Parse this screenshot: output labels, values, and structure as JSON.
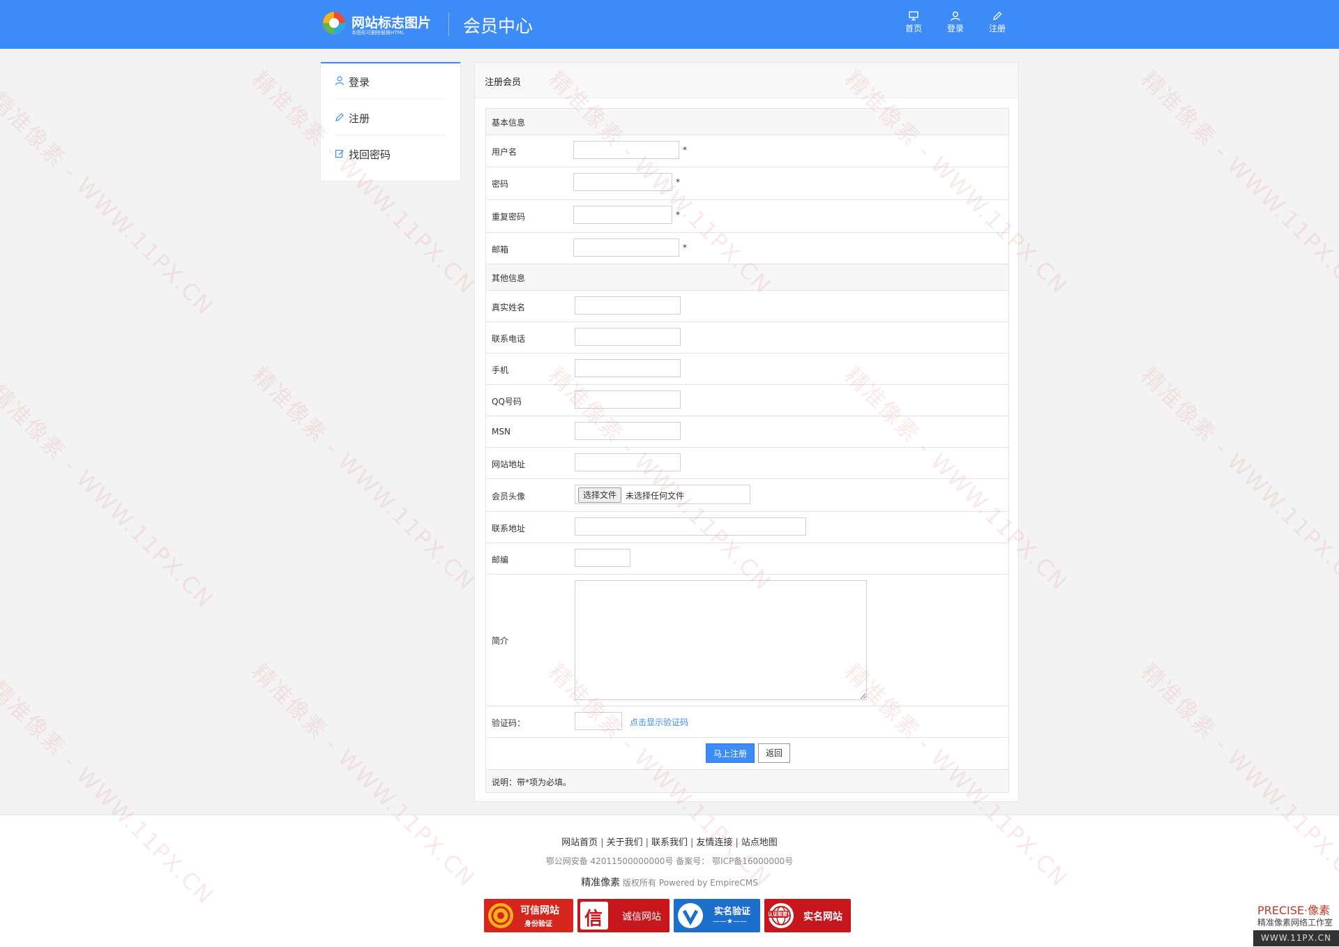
{
  "header": {
    "logo_text": "网站标志图片",
    "logo_sub": "本图形可删除替换HTML",
    "site_title": "会员中心",
    "nav": [
      {
        "label": "首页",
        "icon": "monitor-icon"
      },
      {
        "label": "登录",
        "icon": "user-icon"
      },
      {
        "label": "注册",
        "icon": "pencil-icon"
      }
    ]
  },
  "sidebar": {
    "items": [
      {
        "label": "登录",
        "icon": "user-icon"
      },
      {
        "label": "注册",
        "icon": "pencil-icon"
      },
      {
        "label": "找回密码",
        "icon": "edit-icon"
      }
    ]
  },
  "panel": {
    "title": "注册会员",
    "section_basic": "基本信息",
    "username_label": "用户名",
    "password_label": "密码",
    "repeat_password_label": "重复密码",
    "email_label": "邮箱",
    "required_mark": "*",
    "section_other": "其他信息",
    "realname_label": "真实姓名",
    "phone_label": "联系电话",
    "mobile_label": "手机",
    "qq_label": "QQ号码",
    "msn_label": "MSN",
    "website_label": "网站地址",
    "avatar_label": "会员头像",
    "file_button": "选择文件",
    "file_status": "未选择任何文件",
    "address_label": "联系地址",
    "zip_label": "邮编",
    "intro_label": "简介",
    "captcha_label": "验证码：",
    "captcha_link": "点击显示验证码",
    "submit_button": "马上注册",
    "back_button": "返回",
    "note": "说明：带*项为必填。"
  },
  "footer": {
    "links": [
      "网站首页",
      "关于我们",
      "联系我们",
      "友情连接",
      "站点地图"
    ],
    "link_separator": "|",
    "icp": "鄂公网安备 42011500000000号 备案号： 鄂ICP备16000000号",
    "copyright_brand": "精准像素",
    "copyright_rest": " 版权所有 Powered by EmpireCMS",
    "badges": [
      {
        "line1": "可信网站",
        "line2": "身份验证",
        "color": "#d6251c"
      },
      {
        "line1": "诚信网站",
        "line2": "信",
        "color": "#c8161d"
      },
      {
        "line1": "实名验证",
        "line2": "——★——",
        "color": "#1d6fce"
      },
      {
        "line1": "实名网站",
        "line2": "认证联盟",
        "color": "#c8161d"
      }
    ]
  },
  "watermark": {
    "text": "精准像素 - WWW.11PX.CN",
    "brand_top": "PRECISE·像素",
    "brand_mid": "精准像素网络工作室",
    "brand_url": "WWW.11PX.CN"
  },
  "colors": {
    "accent": "#3c8bf6",
    "background": "#f3f3f3"
  }
}
